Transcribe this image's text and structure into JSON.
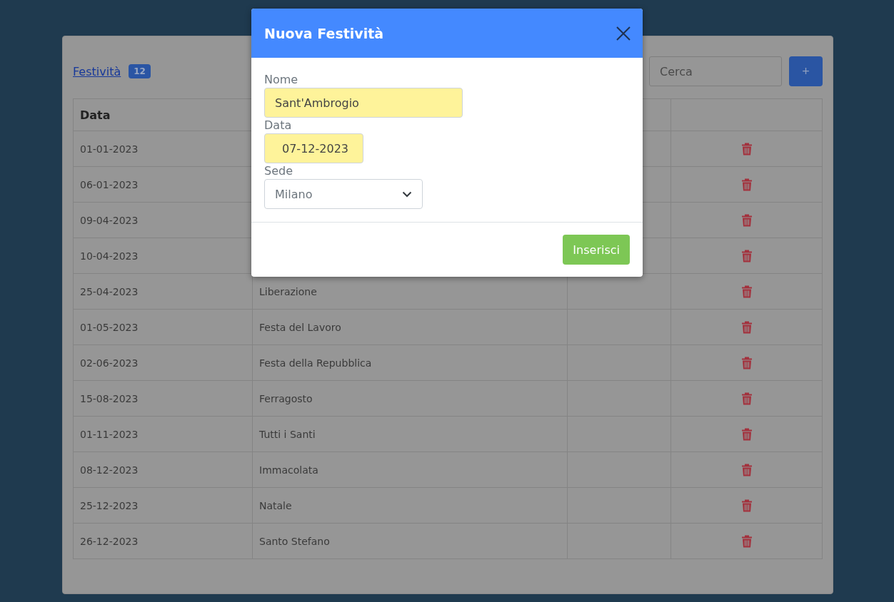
{
  "toolbar": {
    "title_link": "Festività",
    "count": "12",
    "search": {
      "placeholder": "Cerca"
    },
    "add_button": "+"
  },
  "table": {
    "columns": [
      "Data"
    ],
    "rows": [
      {
        "date": "01-01-2023"
      },
      {
        "date": "06-01-2023"
      },
      {
        "date": "09-04-2023"
      },
      {
        "date": "10-04-2023"
      },
      {
        "date": "25-04-2023",
        "name": "Liberazione"
      },
      {
        "date": "01-05-2023",
        "name": "Festa del Lavoro"
      },
      {
        "date": "02-06-2023",
        "name": "Festa della Repubblica"
      },
      {
        "date": "15-08-2023",
        "name": "Ferragosto"
      },
      {
        "date": "01-11-2023",
        "name": "Tutti i Santi"
      },
      {
        "date": "08-12-2023",
        "name": "Immacolata"
      },
      {
        "date": "25-12-2023",
        "name": "Natale"
      },
      {
        "date": "26-12-2023",
        "name": "Santo Stefano"
      }
    ]
  },
  "modal": {
    "title": "Nuova Festività",
    "fields": [
      {
        "kind": "text",
        "label": "Nome",
        "value": "Sant'Ambrogio",
        "highlighted": true
      },
      {
        "kind": "date",
        "label": "Data",
        "value": "07-12-2023",
        "highlighted": true
      },
      {
        "kind": "select",
        "label": "Sede",
        "value": "Milano",
        "highlighted": false
      }
    ],
    "submit": "Inserisci"
  }
}
